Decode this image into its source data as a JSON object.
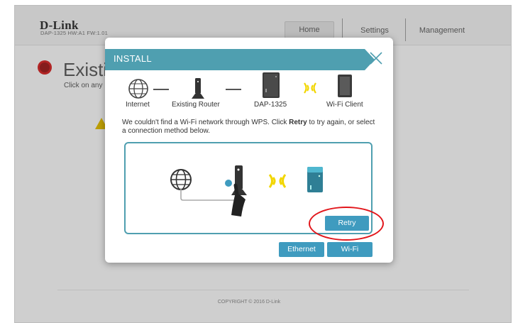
{
  "header": {
    "logo": "D-Link",
    "model_info": "DAP-1325   HW:A1   FW:1.01",
    "nav": {
      "home": "Home",
      "settings": "Settings",
      "management": "Management"
    }
  },
  "background": {
    "status_title": "Existi",
    "status_sub": "Click on any",
    "copyright": "COPYRIGHT © 2016 D-Link"
  },
  "modal": {
    "title": "INSTALL",
    "steps": [
      "Internet",
      "Existing Router",
      "DAP-1325",
      "Wi-Fi Client"
    ],
    "message_before": "We couldn't find a Wi-Fi network through WPS. Click ",
    "message_bold": "Retry",
    "message_after": " to try again, or select a connection method below.",
    "buttons": {
      "retry": "Retry",
      "ethernet": "Ethernet",
      "wifi": "Wi-Fi"
    }
  },
  "colors": {
    "accent": "#4f9fb0",
    "button": "#3f9bbf",
    "highlight": "#e2161b",
    "signal": "#f2d600"
  }
}
